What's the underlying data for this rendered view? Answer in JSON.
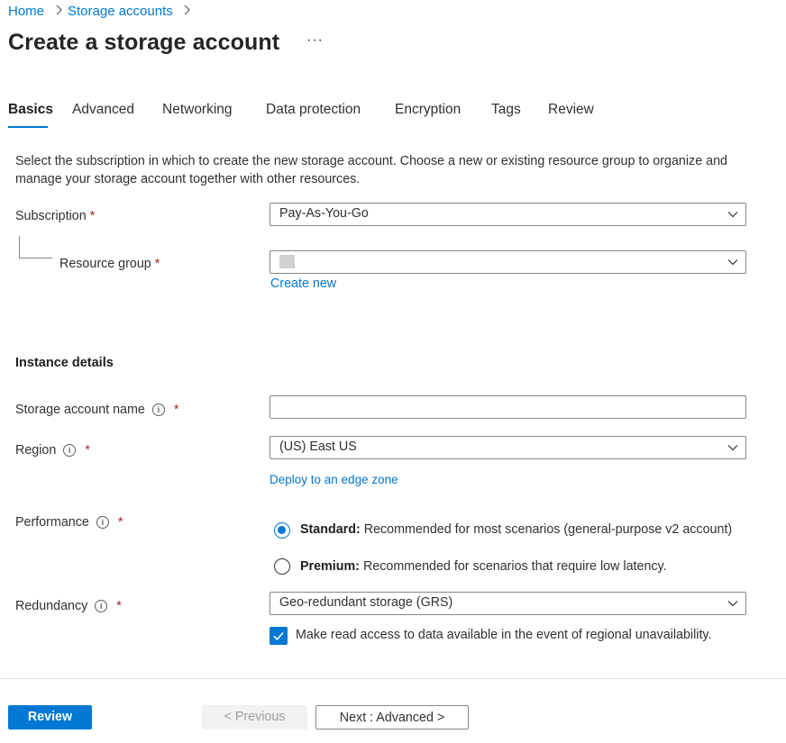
{
  "breadcrumb": {
    "items": [
      "Home",
      "Storage accounts"
    ]
  },
  "page": {
    "title": "Create a storage account",
    "more_label": "···"
  },
  "tabs": [
    {
      "label": "Basics",
      "active": true
    },
    {
      "label": "Advanced"
    },
    {
      "label": "Networking"
    },
    {
      "label": "Data protection"
    },
    {
      "label": "Encryption"
    },
    {
      "label": "Tags"
    },
    {
      "label": "Review"
    }
  ],
  "description": "Select the subscription in which to create the new storage account. Choose a new or existing resource group to organize and manage your storage account together with other resources.",
  "project": {
    "subscription_label": "Subscription",
    "subscription_value": "Pay-As-You-Go",
    "resource_group_label": "Resource group",
    "resource_group_value": "",
    "create_new_label": "Create new"
  },
  "instance": {
    "section_title": "Instance details",
    "name_label": "Storage account name",
    "name_value": "",
    "region_label": "Region",
    "region_value": "(US) East US",
    "edge_zone_label": "Deploy to an edge zone",
    "performance_label": "Performance",
    "performance_options": [
      {
        "title": "Standard:",
        "desc": "Recommended for most scenarios (general-purpose v2 account)",
        "selected": true
      },
      {
        "title": "Premium:",
        "desc": "Recommended for scenarios that require low latency.",
        "selected": false
      }
    ],
    "redundancy_label": "Redundancy",
    "redundancy_value": "Geo-redundant storage (GRS)",
    "read_access_label": "Make read access to data available in the event of regional unavailability.",
    "read_access_checked": true
  },
  "required_mark": "*",
  "info_glyph": "i",
  "footer": {
    "review_label": "Review",
    "previous_label": "< Previous",
    "next_label": "Next : Advanced >"
  },
  "colors": {
    "accent": "#0078d4",
    "required": "#a4262c",
    "border": "#8a8886"
  }
}
